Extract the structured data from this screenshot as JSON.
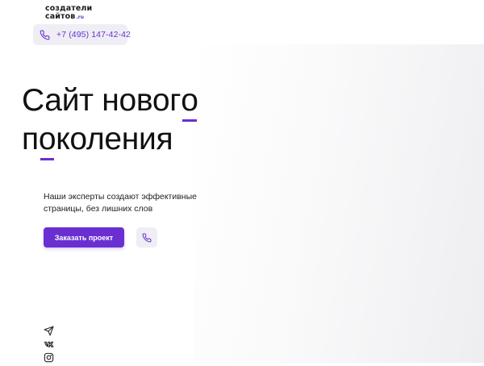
{
  "logo": {
    "line1": "создатели",
    "line2": "сайтов",
    "suffix": ".ru"
  },
  "header": {
    "phone": "+7 (495) 147-42-42"
  },
  "hero": {
    "title_line1_prefix": "Сайт новог",
    "title_line1_accent": "о",
    "title_line2_prefix": "п",
    "title_line2_accent": "о",
    "title_line2_rest": "коления",
    "subtitle_line1": "Наши эксперты создают эффективные",
    "subtitle_line2": "страницы, без лишних слов",
    "cta_label": "Заказать проект"
  },
  "icons": {
    "phone": "phone-icon",
    "call": "phone-icon",
    "socials": [
      "telegram-icon",
      "vk-icon",
      "instagram-icon"
    ]
  },
  "colors": {
    "accent": "#6a2fd1",
    "pill_bg": "#efeef4",
    "text": "#111111"
  }
}
